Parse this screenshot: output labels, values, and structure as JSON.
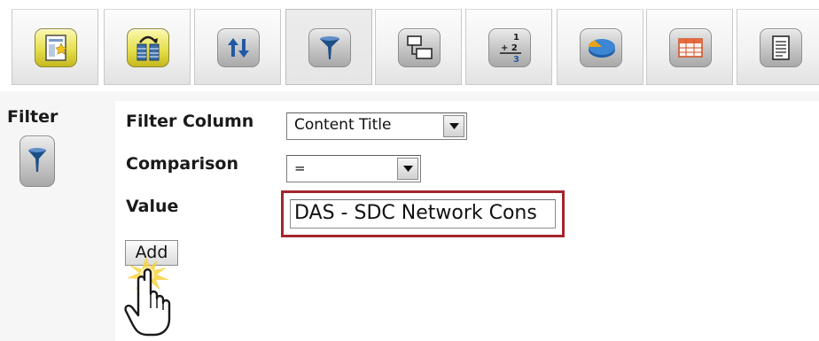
{
  "toolbar": {
    "buttons": [
      {
        "icon": "report-page-icon",
        "tile": "yellow"
      },
      {
        "icon": "data-source-icon",
        "tile": "yellow"
      },
      {
        "icon": "sort-icon",
        "tile": "gray"
      },
      {
        "icon": "filter-funnel-icon",
        "tile": "gray",
        "active": true
      },
      {
        "icon": "group-icon",
        "tile": "gray"
      },
      {
        "icon": "calculation-icon",
        "tile": "gray"
      },
      {
        "icon": "chart-icon",
        "tile": "gray"
      },
      {
        "icon": "table-grid-icon",
        "tile": "gray"
      },
      {
        "icon": "document-lines-icon",
        "tile": "gray"
      }
    ],
    "calc_glyphs": {
      "top": "1",
      "middle": "+ 2",
      "bottom": "3"
    }
  },
  "side": {
    "title": "Filter",
    "icon": "filter-funnel-icon"
  },
  "form": {
    "filter_column_label": "Filter Column",
    "filter_column_value": "Content Title",
    "comparison_label": "Comparison",
    "comparison_value": "=",
    "value_label": "Value",
    "value_text": "DAS - SDC Network Cons",
    "add_label": "Add"
  },
  "colors": {
    "highlight_border": "#a3262d",
    "funnel_blue": "#1c4f86",
    "arrow_blue": "#2159a3",
    "yellow_tile": "#e6df4e"
  }
}
